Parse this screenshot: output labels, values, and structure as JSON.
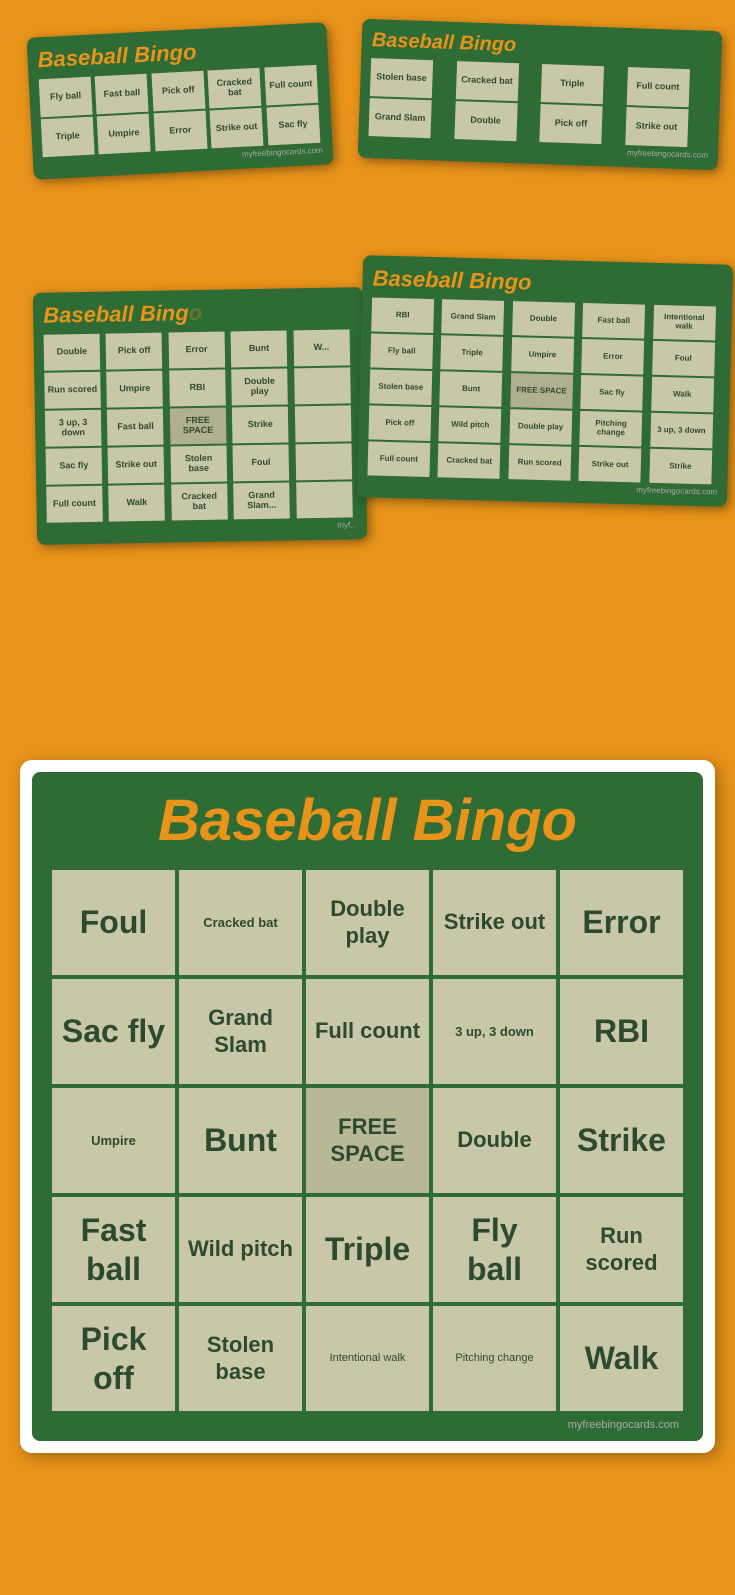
{
  "page": {
    "background_color": "#E8931A",
    "watermark": "myfreebingocards.com"
  },
  "card1": {
    "title": "Baseball Bingo",
    "rows": [
      [
        "Fly ball",
        "Fast ball",
        "Pick off",
        "Cracked bat",
        "Full count"
      ],
      [
        "Triple",
        "Umpire",
        "Error",
        "Strike out",
        "Sac fly"
      ]
    ]
  },
  "card2": {
    "title": "Baseball Bingo",
    "rows": [
      [
        "Stolen base",
        "Cracked bat",
        "Triple",
        "Full count"
      ],
      [
        "Grand Slam",
        "Double",
        "Pick off",
        "Strike out"
      ]
    ]
  },
  "card3": {
    "title": "Baseball Bingo",
    "rows": [
      [
        "Double",
        "Pick off",
        "Error",
        "Bunt",
        "W"
      ],
      [
        "Run scored",
        "Umpire",
        "RBI",
        "Double play",
        ""
      ],
      [
        "3 up, 3 down",
        "Fast ball",
        "FREE SPACE",
        "Strike",
        ""
      ],
      [
        "Sac fly",
        "Strike out",
        "Stolen base",
        "Foul",
        ""
      ],
      [
        "Full count",
        "Walk",
        "Cracked bat",
        "Grand Slam",
        ""
      ]
    ]
  },
  "card4": {
    "title": "Baseball Bingo",
    "rows": [
      [
        "RBI",
        "Grand Slam",
        "Double",
        "Fast ball",
        "Intentional walk"
      ],
      [
        "Fly ball",
        "Triple",
        "Umpire",
        "Error",
        "Foul"
      ],
      [
        "Stolen base",
        "Bunt",
        "FREE SPACE",
        "Sac fly",
        "Walk"
      ],
      [
        "Pick off",
        "Wild pitch",
        "Double play",
        "Pitching change",
        "3 up, 3 down"
      ],
      [
        "Full count",
        "Cracked bat",
        "Run scored",
        "Strike out",
        "Strike"
      ]
    ]
  },
  "main_card": {
    "title": "Baseball Bingo",
    "cells": [
      {
        "text": "Foul",
        "size": "large"
      },
      {
        "text": "Cracked bat",
        "size": "small"
      },
      {
        "text": "Double play",
        "size": "medium"
      },
      {
        "text": "Strike out",
        "size": "medium"
      },
      {
        "text": "Error",
        "size": "large"
      },
      {
        "text": "Sac fly",
        "size": "large"
      },
      {
        "text": "Grand Slam",
        "size": "medium"
      },
      {
        "text": "Full count",
        "size": "medium"
      },
      {
        "text": "3 up, 3 down",
        "size": "small"
      },
      {
        "text": "RBI",
        "size": "large"
      },
      {
        "text": "Umpire",
        "size": "small"
      },
      {
        "text": "Bunt",
        "size": "large"
      },
      {
        "text": "FREE SPACE",
        "size": "medium",
        "free": true
      },
      {
        "text": "Double",
        "size": "medium"
      },
      {
        "text": "Strike",
        "size": "large"
      },
      {
        "text": "Fast ball",
        "size": "large"
      },
      {
        "text": "Wild pitch",
        "size": "medium"
      },
      {
        "text": "Triple",
        "size": "large"
      },
      {
        "text": "Fly ball",
        "size": "large"
      },
      {
        "text": "Run scored",
        "size": "medium"
      },
      {
        "text": "Pick off",
        "size": "large"
      },
      {
        "text": "Stolen base",
        "size": "medium"
      },
      {
        "text": "Intentional walk",
        "size": "tiny"
      },
      {
        "text": "Pitching change",
        "size": "tiny"
      },
      {
        "text": "Walk",
        "size": "large"
      }
    ],
    "watermark": "myfreebingocards.com"
  }
}
